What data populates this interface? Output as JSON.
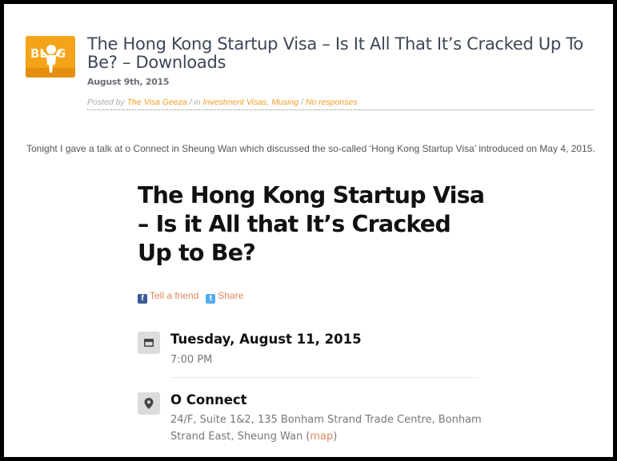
{
  "post": {
    "badge_text": "BLOG",
    "title": "The Hong Kong Startup Visa – Is It All That It’s Cracked Up To Be? – Downloads",
    "date": "August 9th, 2015",
    "meta": {
      "posted_by": "Posted by ",
      "author": "The Visa Geeza",
      "in": " / in ",
      "category1": "Investment Visas",
      "comma": ", ",
      "category2": "Musing",
      "slash": " / ",
      "responses": "No responses"
    },
    "intro": "Tonight I gave a talk at o Connect in Sheung Wan which discussed the so-called ‘Hong Kong Startup Visa’ introduced on May 4, 2015."
  },
  "event": {
    "title": "The Hong Kong Startup Visa – Is it All that It’s Cracked Up to Be?",
    "social": {
      "tell": "Tell a friend",
      "share": "Share"
    },
    "date_title": "Tuesday, August 11, 2015",
    "time": "7:00 PM",
    "venue": "O Connect",
    "address": "24/F, Suite 1&2, 135 Bonham Strand Trade Centre, Bonham Strand East, Sheung Wan (",
    "map": "map",
    "address_end": ")"
  },
  "colors": {
    "accent": "#f39a1e",
    "link": "#e0885c",
    "badge": "#f5a31a"
  },
  "icons": [
    "blog-badge-icon",
    "facebook-icon",
    "twitter-icon",
    "calendar-icon",
    "location-pin-icon"
  ]
}
